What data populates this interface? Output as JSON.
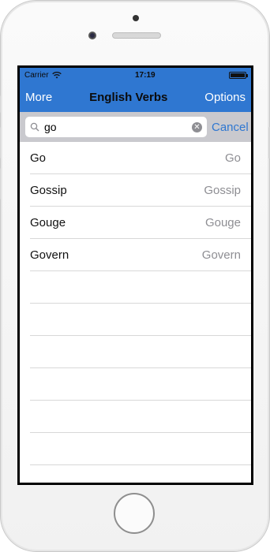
{
  "status": {
    "carrier": "Carrier",
    "time": "17:19"
  },
  "nav": {
    "left": "More",
    "title": "English Verbs",
    "right": "Options"
  },
  "search": {
    "value": "go",
    "cancel": "Cancel"
  },
  "results": [
    {
      "title": "Go",
      "detail": "Go"
    },
    {
      "title": "Gossip",
      "detail": "Gossip"
    },
    {
      "title": "Gouge",
      "detail": "Gouge"
    },
    {
      "title": "Govern",
      "detail": "Govern"
    }
  ],
  "colors": {
    "accent": "#2f77d1",
    "nav_bg": "#2f77d1",
    "search_bg": "#c9c9ce"
  }
}
